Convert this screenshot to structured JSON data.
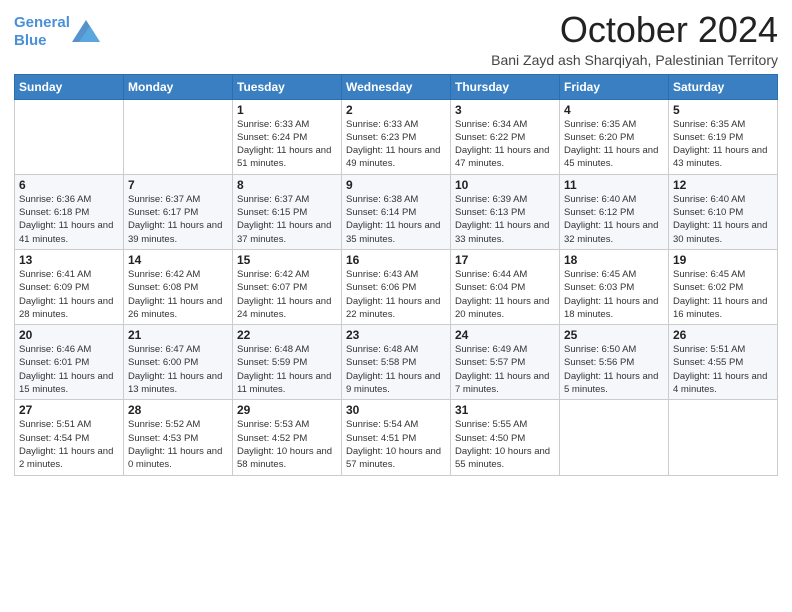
{
  "logo": {
    "line1": "General",
    "line2": "Blue"
  },
  "title": "October 2024",
  "location": "Bani Zayd ash Sharqiyah, Palestinian Territory",
  "weekdays": [
    "Sunday",
    "Monday",
    "Tuesday",
    "Wednesday",
    "Thursday",
    "Friday",
    "Saturday"
  ],
  "weeks": [
    [
      {
        "day": "",
        "info": ""
      },
      {
        "day": "",
        "info": ""
      },
      {
        "day": "1",
        "info": "Sunrise: 6:33 AM\nSunset: 6:24 PM\nDaylight: 11 hours and 51 minutes."
      },
      {
        "day": "2",
        "info": "Sunrise: 6:33 AM\nSunset: 6:23 PM\nDaylight: 11 hours and 49 minutes."
      },
      {
        "day": "3",
        "info": "Sunrise: 6:34 AM\nSunset: 6:22 PM\nDaylight: 11 hours and 47 minutes."
      },
      {
        "day": "4",
        "info": "Sunrise: 6:35 AM\nSunset: 6:20 PM\nDaylight: 11 hours and 45 minutes."
      },
      {
        "day": "5",
        "info": "Sunrise: 6:35 AM\nSunset: 6:19 PM\nDaylight: 11 hours and 43 minutes."
      }
    ],
    [
      {
        "day": "6",
        "info": "Sunrise: 6:36 AM\nSunset: 6:18 PM\nDaylight: 11 hours and 41 minutes."
      },
      {
        "day": "7",
        "info": "Sunrise: 6:37 AM\nSunset: 6:17 PM\nDaylight: 11 hours and 39 minutes."
      },
      {
        "day": "8",
        "info": "Sunrise: 6:37 AM\nSunset: 6:15 PM\nDaylight: 11 hours and 37 minutes."
      },
      {
        "day": "9",
        "info": "Sunrise: 6:38 AM\nSunset: 6:14 PM\nDaylight: 11 hours and 35 minutes."
      },
      {
        "day": "10",
        "info": "Sunrise: 6:39 AM\nSunset: 6:13 PM\nDaylight: 11 hours and 33 minutes."
      },
      {
        "day": "11",
        "info": "Sunrise: 6:40 AM\nSunset: 6:12 PM\nDaylight: 11 hours and 32 minutes."
      },
      {
        "day": "12",
        "info": "Sunrise: 6:40 AM\nSunset: 6:10 PM\nDaylight: 11 hours and 30 minutes."
      }
    ],
    [
      {
        "day": "13",
        "info": "Sunrise: 6:41 AM\nSunset: 6:09 PM\nDaylight: 11 hours and 28 minutes."
      },
      {
        "day": "14",
        "info": "Sunrise: 6:42 AM\nSunset: 6:08 PM\nDaylight: 11 hours and 26 minutes."
      },
      {
        "day": "15",
        "info": "Sunrise: 6:42 AM\nSunset: 6:07 PM\nDaylight: 11 hours and 24 minutes."
      },
      {
        "day": "16",
        "info": "Sunrise: 6:43 AM\nSunset: 6:06 PM\nDaylight: 11 hours and 22 minutes."
      },
      {
        "day": "17",
        "info": "Sunrise: 6:44 AM\nSunset: 6:04 PM\nDaylight: 11 hours and 20 minutes."
      },
      {
        "day": "18",
        "info": "Sunrise: 6:45 AM\nSunset: 6:03 PM\nDaylight: 11 hours and 18 minutes."
      },
      {
        "day": "19",
        "info": "Sunrise: 6:45 AM\nSunset: 6:02 PM\nDaylight: 11 hours and 16 minutes."
      }
    ],
    [
      {
        "day": "20",
        "info": "Sunrise: 6:46 AM\nSunset: 6:01 PM\nDaylight: 11 hours and 15 minutes."
      },
      {
        "day": "21",
        "info": "Sunrise: 6:47 AM\nSunset: 6:00 PM\nDaylight: 11 hours and 13 minutes."
      },
      {
        "day": "22",
        "info": "Sunrise: 6:48 AM\nSunset: 5:59 PM\nDaylight: 11 hours and 11 minutes."
      },
      {
        "day": "23",
        "info": "Sunrise: 6:48 AM\nSunset: 5:58 PM\nDaylight: 11 hours and 9 minutes."
      },
      {
        "day": "24",
        "info": "Sunrise: 6:49 AM\nSunset: 5:57 PM\nDaylight: 11 hours and 7 minutes."
      },
      {
        "day": "25",
        "info": "Sunrise: 6:50 AM\nSunset: 5:56 PM\nDaylight: 11 hours and 5 minutes."
      },
      {
        "day": "26",
        "info": "Sunrise: 5:51 AM\nSunset: 4:55 PM\nDaylight: 11 hours and 4 minutes."
      }
    ],
    [
      {
        "day": "27",
        "info": "Sunrise: 5:51 AM\nSunset: 4:54 PM\nDaylight: 11 hours and 2 minutes."
      },
      {
        "day": "28",
        "info": "Sunrise: 5:52 AM\nSunset: 4:53 PM\nDaylight: 11 hours and 0 minutes."
      },
      {
        "day": "29",
        "info": "Sunrise: 5:53 AM\nSunset: 4:52 PM\nDaylight: 10 hours and 58 minutes."
      },
      {
        "day": "30",
        "info": "Sunrise: 5:54 AM\nSunset: 4:51 PM\nDaylight: 10 hours and 57 minutes."
      },
      {
        "day": "31",
        "info": "Sunrise: 5:55 AM\nSunset: 4:50 PM\nDaylight: 10 hours and 55 minutes."
      },
      {
        "day": "",
        "info": ""
      },
      {
        "day": "",
        "info": ""
      }
    ]
  ]
}
